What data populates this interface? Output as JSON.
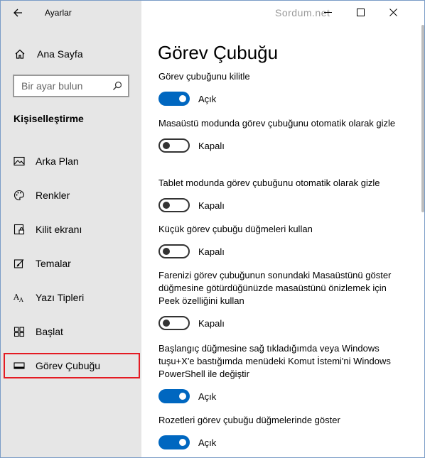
{
  "window": {
    "app_title": "Ayarlar",
    "watermark": "Sordum.net"
  },
  "sidebar": {
    "home_label": "Ana Sayfa",
    "search_placeholder": "Bir ayar bulun",
    "section_title": "Kişiselleştirme",
    "items": [
      {
        "label": "Arka Plan",
        "icon": "picture-icon"
      },
      {
        "label": "Renkler",
        "icon": "palette-icon"
      },
      {
        "label": "Kilit ekranı",
        "icon": "lock-screen-icon"
      },
      {
        "label": "Temalar",
        "icon": "themes-icon"
      },
      {
        "label": "Yazı Tipleri",
        "icon": "fonts-icon"
      },
      {
        "label": "Başlat",
        "icon": "start-icon"
      },
      {
        "label": "Görev Çubuğu",
        "icon": "taskbar-icon",
        "active": true
      }
    ]
  },
  "main": {
    "title": "Görev Çubuğu",
    "settings": [
      {
        "desc": "Görev çubuğunu kilitle",
        "state": "on",
        "state_label": "Açık"
      },
      {
        "desc": "Masaüstü modunda görev çubuğunu otomatik olarak gizle",
        "state": "off",
        "state_label": "Kapalı"
      },
      {
        "desc": "Tablet modunda görev çubuğunu otomatik olarak gizle",
        "state": "off",
        "state_label": "Kapalı"
      },
      {
        "desc": "Küçük görev çubuğu düğmeleri kullan",
        "state": "off",
        "state_label": "Kapalı"
      },
      {
        "desc": "Farenizi görev çubuğunun sonundaki Masaüstünü göster düğmesine götürdüğünüzde masaüstünü önizlemek için Peek özelliğini kullan",
        "state": "off",
        "state_label": "Kapalı"
      },
      {
        "desc": "Başlangıç düğmesine sağ tıkladığımda veya Windows tuşu+X'e bastığımda menüdeki Komut İstemi'ni Windows PowerShell ile değiştir",
        "state": "on",
        "state_label": "Açık"
      },
      {
        "desc": "Rozetleri görev çubuğu düğmelerinde göster",
        "state": "on",
        "state_label": "Açık"
      }
    ]
  },
  "colors": {
    "accent": "#0067c0",
    "sidebar_bg": "#e6e6e6",
    "highlight": "#e41b23"
  }
}
